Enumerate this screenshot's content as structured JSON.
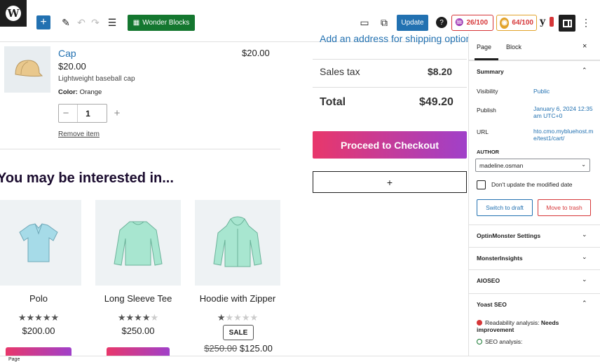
{
  "toolbar": {
    "wonder_blocks_label": "Wonder Blocks",
    "update_label": "Update",
    "readability_score": "26/100",
    "seo_score": "64/100"
  },
  "cart": {
    "item_name": "Cap",
    "item_price": "$20.00",
    "item_description": "Lightweight baseball cap",
    "color_label": "Color:",
    "color_value": "Orange",
    "quantity": "1",
    "qty_minus": "−",
    "qty_plus": "+",
    "remove_label": "Remove item",
    "item_total": "$20.00"
  },
  "interested": {
    "title": "You may be interested in...",
    "products": [
      {
        "name": "Polo",
        "price": "$200.00",
        "rating": 5
      },
      {
        "name": "Long Sleeve Tee",
        "price": "$250.00",
        "rating": 4
      },
      {
        "name": "Hoodie with Zipper",
        "rating": 1,
        "sale_badge": "SALE",
        "old_price": "$250.00",
        "new_price": "$125.00"
      }
    ]
  },
  "totals": {
    "shipping_link": "Add an address for shipping options",
    "sales_tax_label": "Sales tax",
    "sales_tax_value": "$8.20",
    "total_label": "Total",
    "total_value": "$49.20",
    "checkout_label": "Proceed to Checkout",
    "append_label": "+"
  },
  "sidebar": {
    "tab_page": "Page",
    "tab_block": "Block",
    "close": "×",
    "summary_title": "Summary",
    "visibility_label": "Visibility",
    "visibility_value": "Public",
    "publish_label": "Publish",
    "publish_value": "January 6, 2024 12:35 am UTC+0",
    "url_label": "URL",
    "url_value": "hto.cmo.mybluehost.me/test1/cart/",
    "author_label": "AUTHOR",
    "author_value": "madeline.osman",
    "modified_label": "Don't update the modified date",
    "draft_label": "Switch to draft",
    "trash_label": "Move to trash",
    "sections": [
      "OptinMonster Settings",
      "MonsterInsights",
      "AIOSEO"
    ],
    "yoast_title": "Yoast SEO",
    "readability_label": "Readability analysis:",
    "readability_value": "Needs improvement",
    "seo_label": "SEO analysis:"
  },
  "status": {
    "label": "Page"
  },
  "colors": {
    "accent": "#2271b1",
    "checkout_gradient_start": "#e8376b",
    "checkout_gradient_end": "#a040c9",
    "error": "#d63638",
    "warning": "#e2a32b"
  }
}
